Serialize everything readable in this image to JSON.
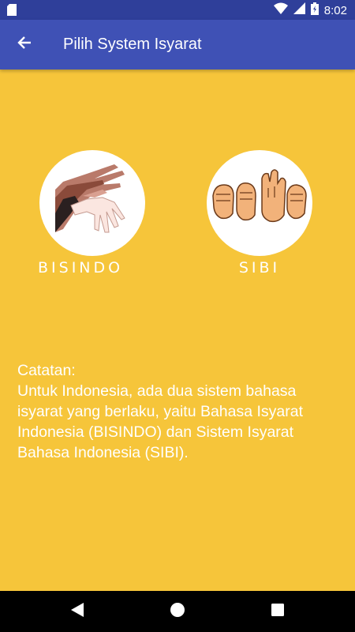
{
  "status_bar": {
    "time": "8:02",
    "icons": [
      "sd-card-icon",
      "wifi-icon",
      "signal-icon",
      "battery-icon"
    ]
  },
  "app_bar": {
    "title": "Pilih System Isyarat",
    "back_icon": "arrow-back-icon"
  },
  "options": [
    {
      "label": "BISINDO",
      "image": "bisindo-hands-image"
    },
    {
      "label": "SIBI",
      "image": "sibi-fingerspelling-image"
    }
  ],
  "note": {
    "heading": "Catatan:",
    "body": "Untuk Indonesia, ada dua sistem bahasa isyarat yang berlaku, yaitu Bahasa Isyarat Indonesia (BISINDO) dan Sistem Isyarat Bahasa Indonesia (SIBI)."
  },
  "nav_bar": {
    "icons": [
      "nav-back-icon",
      "nav-home-icon",
      "nav-recents-icon"
    ]
  },
  "colors": {
    "background": "#f6c53a",
    "app_bar": "#3f51b5",
    "status_bar": "#2f3f9a",
    "text": "#ffffff"
  }
}
